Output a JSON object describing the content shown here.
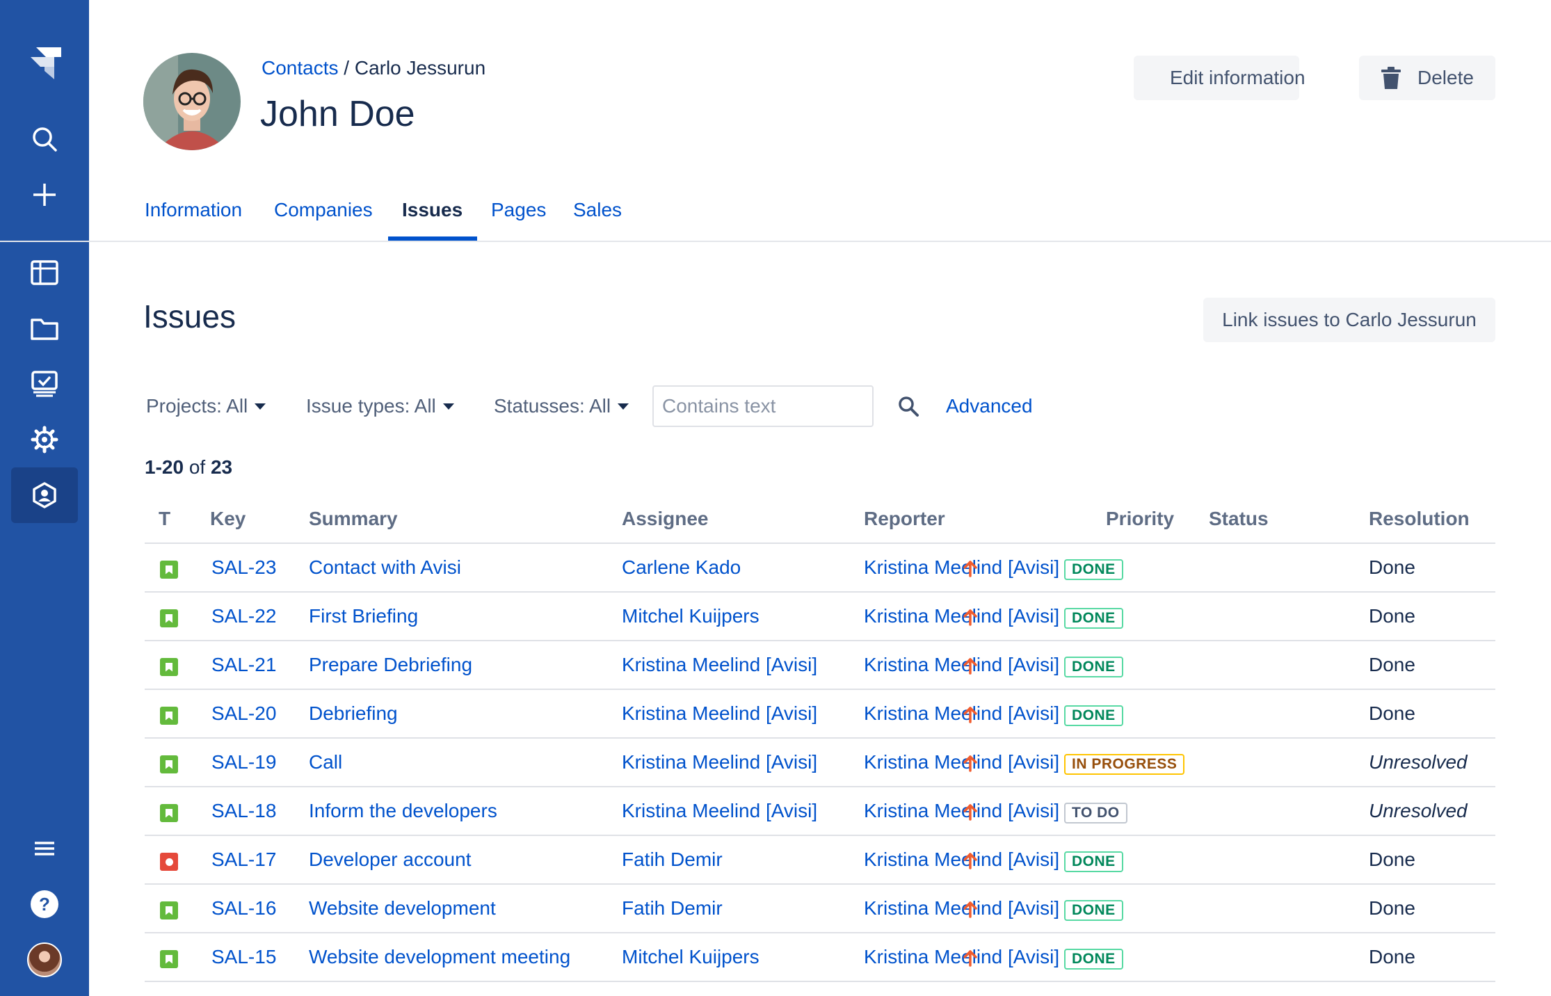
{
  "sidebar": {
    "items": [
      {
        "icon": "jira-logo-icon"
      },
      {
        "icon": "search-icon"
      },
      {
        "icon": "plus-icon"
      },
      {
        "icon": "board-icon"
      },
      {
        "icon": "folder-icon"
      },
      {
        "icon": "checklist-icon"
      },
      {
        "icon": "gear-icon"
      },
      {
        "icon": "contacts-app-icon",
        "active": true
      },
      {
        "icon": "menu-icon"
      },
      {
        "icon": "help-icon"
      },
      {
        "icon": "user-avatar"
      }
    ]
  },
  "header": {
    "breadcrumb_link": "Contacts",
    "breadcrumb_separator": " / ",
    "breadcrumb_current": "Carlo Jessurun",
    "title": "John Doe",
    "edit_label": "Edit information",
    "delete_label": "Delete"
  },
  "tabs": [
    {
      "label": "Information"
    },
    {
      "label": "Companies"
    },
    {
      "label": "Issues",
      "active": true
    },
    {
      "label": "Pages"
    },
    {
      "label": "Sales"
    }
  ],
  "section": {
    "title": "Issues",
    "link_button": "Link issues to Carlo Jessurun"
  },
  "filters": {
    "projects": "Projects: All",
    "issue_types": "Issue types: All",
    "statuses": "Statusses: All",
    "text_placeholder": "Contains text",
    "advanced": "Advanced"
  },
  "count": {
    "range": "1-20",
    "of": " of ",
    "total": "23"
  },
  "table": {
    "columns": [
      "T",
      "Key",
      "Summary",
      "Assignee",
      "Reporter",
      "Priority",
      "Status",
      "Resolution"
    ],
    "rows": [
      {
        "type": "story",
        "key": "SAL-23",
        "summary": "Contact with Avisi",
        "assignee": "Carlene Kado",
        "reporter": "Kristina Meelind [Avisi]",
        "priority": "high",
        "status": "DONE",
        "status_kind": "done",
        "resolution": "Done"
      },
      {
        "type": "story",
        "key": "SAL-22",
        "summary": "First Briefing",
        "assignee": "Mitchel Kuijpers",
        "reporter": "Kristina Meelind [Avisi]",
        "priority": "high",
        "status": "DONE",
        "status_kind": "done",
        "resolution": "Done"
      },
      {
        "type": "story",
        "key": "SAL-21",
        "summary": "Prepare Debriefing",
        "assignee": "Kristina Meelind [Avisi]",
        "reporter": "Kristina Meelind [Avisi]",
        "priority": "high",
        "status": "DONE",
        "status_kind": "done",
        "resolution": "Done"
      },
      {
        "type": "story",
        "key": "SAL-20",
        "summary": "Debriefing",
        "assignee": "Kristina Meelind [Avisi]",
        "reporter": "Kristina Meelind [Avisi]",
        "priority": "high",
        "status": "DONE",
        "status_kind": "done",
        "resolution": "Done"
      },
      {
        "type": "story",
        "key": "SAL-19",
        "summary": "Call",
        "assignee": "Kristina Meelind [Avisi]",
        "reporter": "Kristina Meelind [Avisi]",
        "priority": "high",
        "status": "IN PROGRESS",
        "status_kind": "progress",
        "resolution": "Unresolved"
      },
      {
        "type": "story",
        "key": "SAL-18",
        "summary": "Inform the developers",
        "assignee": "Kristina Meelind [Avisi]",
        "reporter": "Kristina Meelind [Avisi]",
        "priority": "high",
        "status": "TO DO",
        "status_kind": "todo",
        "resolution": "Unresolved"
      },
      {
        "type": "bug",
        "key": "SAL-17",
        "summary": "Developer account",
        "assignee": "Fatih Demir",
        "reporter": "Kristina Meelind [Avisi]",
        "priority": "high",
        "status": "DONE",
        "status_kind": "done",
        "resolution": "Done"
      },
      {
        "type": "story",
        "key": "SAL-16",
        "summary": "Website development",
        "assignee": "Fatih Demir",
        "reporter": "Kristina Meelind [Avisi]",
        "priority": "high",
        "status": "DONE",
        "status_kind": "done",
        "resolution": "Done"
      },
      {
        "type": "story",
        "key": "SAL-15",
        "summary": "Website development meeting",
        "assignee": "Mitchel Kuijpers",
        "reporter": "Kristina Meelind [Avisi]",
        "priority": "high",
        "status": "DONE",
        "status_kind": "done",
        "resolution": "Done"
      }
    ]
  },
  "colors": {
    "sidebar": "#2153a4",
    "link": "#0052cc",
    "text": "#172b4d",
    "done": "#00875a",
    "in_progress": "#974f0c",
    "priority_high": "#f15c2e"
  }
}
